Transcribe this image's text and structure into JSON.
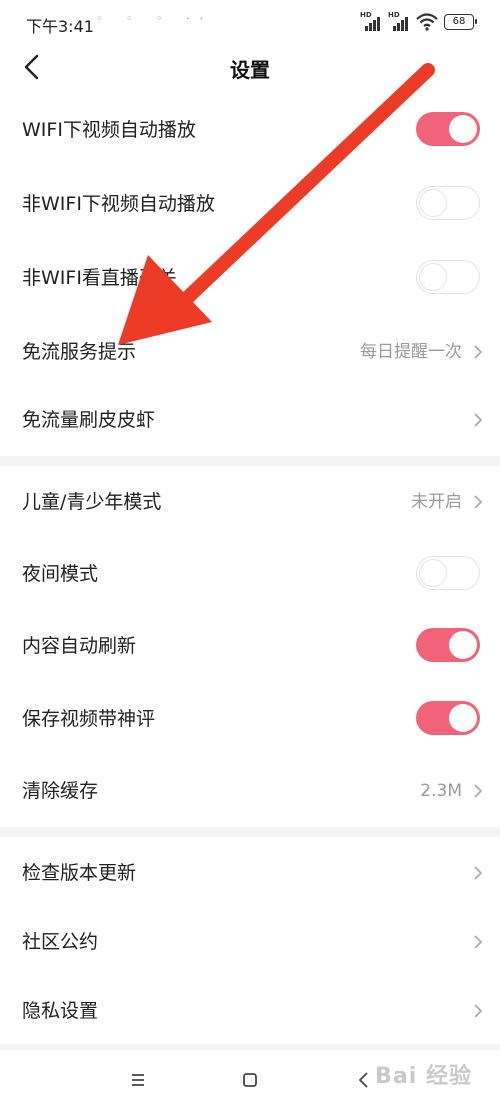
{
  "status_bar": {
    "time": "下午3:41",
    "notif_icons": "◦ ◦ ◦ ··",
    "hd_label": "HD",
    "battery": "68"
  },
  "header": {
    "title": "设置"
  },
  "section1": [
    {
      "label": "WIFI下视频自动播放",
      "toggle": "on"
    },
    {
      "label": "非WIFI下视频自动播放",
      "toggle": "off"
    },
    {
      "label": "非WIFI看直播开关",
      "toggle": "off"
    },
    {
      "label": "免流服务提示",
      "value": "每日提醒一次"
    },
    {
      "label": "免流量刷皮皮虾",
      "value": ""
    }
  ],
  "section2": [
    {
      "label": "儿童/青少年模式",
      "value": "未开启"
    },
    {
      "label": "夜间模式",
      "toggle": "off"
    },
    {
      "label": "内容自动刷新",
      "toggle": "on"
    },
    {
      "label": "保存视频带神评",
      "toggle": "on"
    },
    {
      "label": "清除缓存",
      "value": "2.3M"
    }
  ],
  "section3": [
    {
      "label": "检查版本更新"
    },
    {
      "label": "社区公约"
    },
    {
      "label": "隐私设置"
    }
  ],
  "colors": {
    "accent": "#f2637a",
    "annotation_arrow": "#ec3b27"
  },
  "watermark": "Bai 经验"
}
